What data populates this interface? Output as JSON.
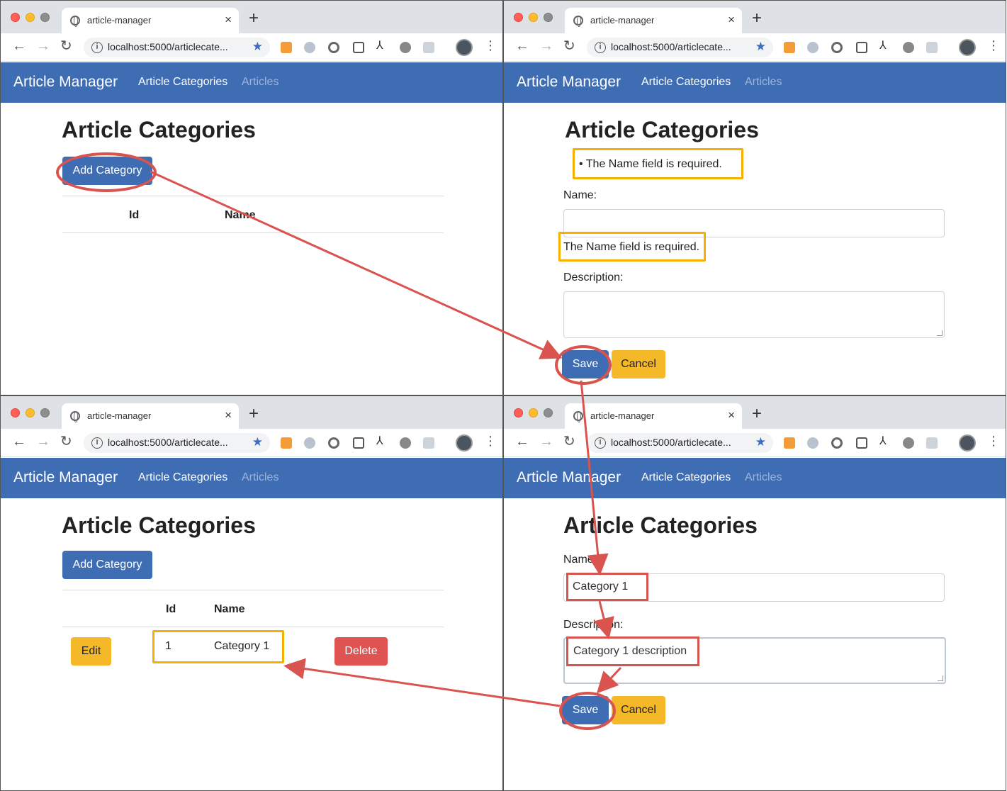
{
  "browser": {
    "tab_title": "article-manager",
    "tab_close": "×",
    "new_tab": "+",
    "url": "localhost:5000/articlecate...",
    "info_glyph": "i",
    "star_glyph": "★",
    "back_glyph": "←",
    "forward_glyph": "→",
    "reload_glyph": "↻",
    "menu_glyph": "⋮"
  },
  "app": {
    "brand": "Article Manager",
    "nav_categories": "Article Categories",
    "nav_articles": "Articles"
  },
  "page": {
    "heading": "Article Categories",
    "add_button": "Add Category",
    "col_id": "Id",
    "col_name": "Name"
  },
  "form": {
    "summary_error": "The Name field is required.",
    "name_label": "Name:",
    "name_error": "The Name field is required.",
    "description_label": "Description:",
    "save_button": "Save",
    "cancel_button": "Cancel",
    "name_value": "Category 1",
    "description_value": "Category 1 description"
  },
  "table": {
    "rows": [
      {
        "id": "1",
        "name": "Category 1",
        "edit": "Edit",
        "delete": "Delete"
      }
    ]
  },
  "annotations": {
    "color": "#d9534f",
    "highlight_color": "#f5b000"
  }
}
